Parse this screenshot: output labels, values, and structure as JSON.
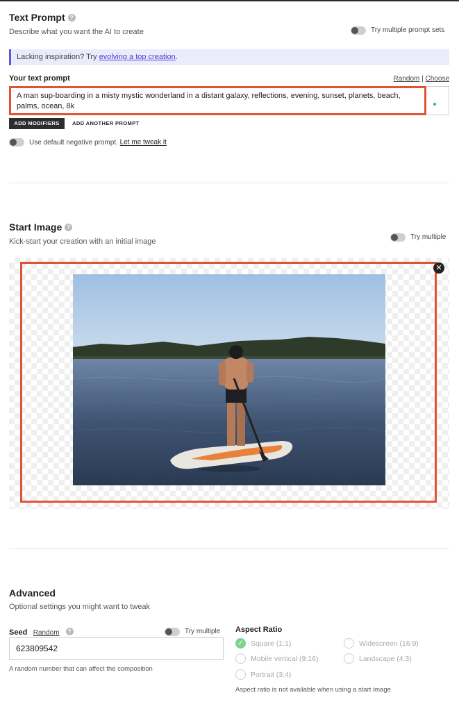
{
  "text_prompt": {
    "title": "Text Prompt",
    "help": "?",
    "subtitle": "Describe what you want the AI to create",
    "toggle_label": "Try multiple prompt sets",
    "banner_prefix": "Lacking inspiration? Try ",
    "banner_link": "evolving a top creation",
    "banner_suffix": ".",
    "field_label": "Your text prompt",
    "random_link": "Random",
    "separator": "|",
    "choose_link": "Choose",
    "prompt_value": "A man sup-boarding in a misty mystic wonderland in a distant galaxy, reflections, evening, sunset, planets, beach, palms, ocean, 8k",
    "add_modifiers": "ADD MODIFIERS",
    "add_another": "ADD ANOTHER PROMPT",
    "negative_text": "Use default negative prompt. ",
    "negative_link": "Let me tweak it"
  },
  "start_image": {
    "title": "Start Image",
    "help": "?",
    "subtitle": "Kick-start your creation with an initial image",
    "toggle_label": "Try multiple",
    "close_symbol": "✕"
  },
  "advanced": {
    "title": "Advanced",
    "subtitle": "Optional settings you might want to tweak",
    "seed_label": "Seed",
    "seed_random": "Random",
    "help": "?",
    "toggle_label": "Try multiple",
    "seed_value": "623809542",
    "seed_note": "A random number that can affect the composition",
    "aspect_label": "Aspect Ratio",
    "aspect_options": [
      {
        "label": "Square (1:1)",
        "checked": true
      },
      {
        "label": "Widescreen (16:9)",
        "checked": false
      },
      {
        "label": "Mobile vertical (9:16)",
        "checked": false
      },
      {
        "label": "Landscape (4:3)",
        "checked": false
      },
      {
        "label": "Portrait (3:4)",
        "checked": false
      }
    ],
    "check_symbol": "✓",
    "aspect_note": "Aspect ratio is not available when using a start image"
  },
  "colors": {
    "accent_red": "#e05336",
    "banner_bg": "#ecebfc",
    "banner_link": "#4b3fd1",
    "check_green": "#7ed38f"
  }
}
